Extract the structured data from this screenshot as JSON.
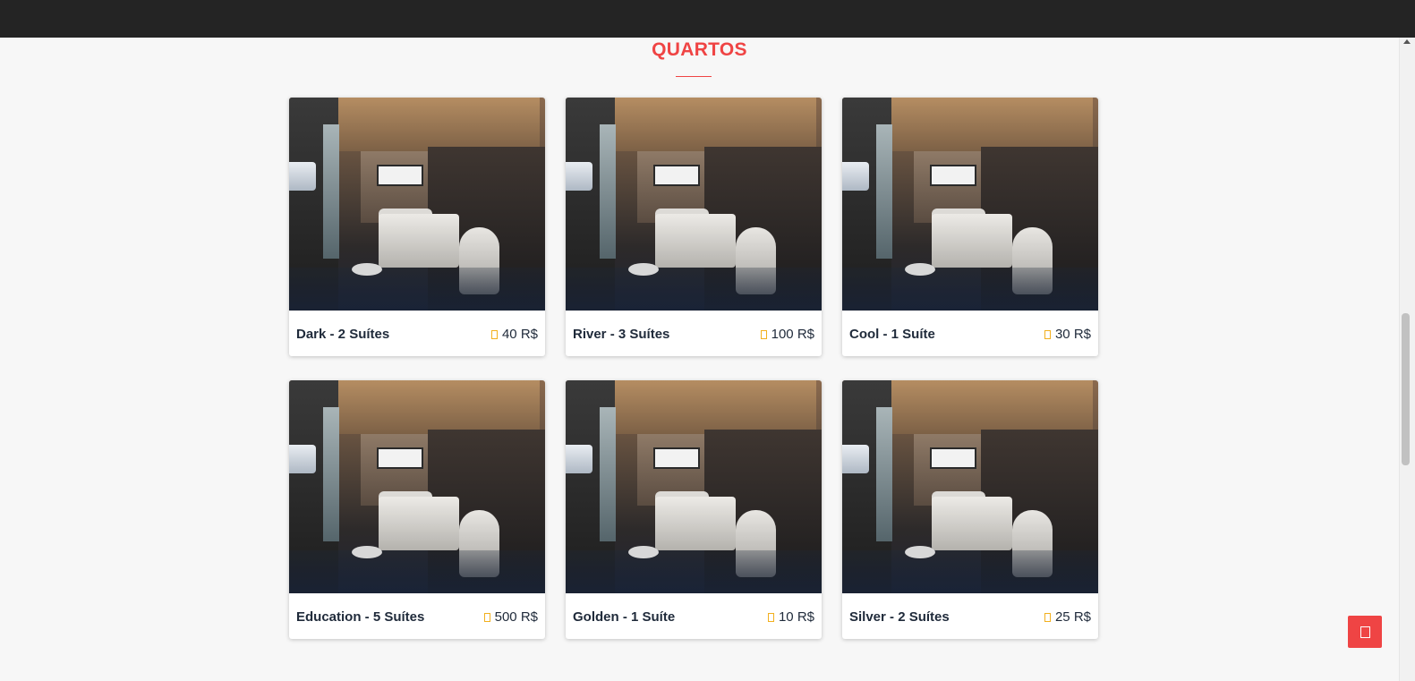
{
  "section": {
    "title": "QUARTOS"
  },
  "rooms": [
    {
      "name": "Dark - 2 Suítes",
      "price": "40 R$",
      "price_icon": "dollar-icon"
    },
    {
      "name": "River - 3 Suítes",
      "price": "100 R$",
      "price_icon": "dollar-icon"
    },
    {
      "name": "Cool - 1 Suíte",
      "price": "30 R$",
      "price_icon": "dollar-icon"
    },
    {
      "name": "Education - 5 Suítes",
      "price": "500 R$",
      "price_icon": "dollar-icon"
    },
    {
      "name": "Golden - 1 Suíte",
      "price": "10 R$",
      "price_icon": "dollar-icon"
    },
    {
      "name": "Silver - 2 Suítes",
      "price": "25 R$",
      "price_icon": "dollar-icon"
    }
  ],
  "colors": {
    "accent": "#ef4444",
    "price_icon": "#f2b01e",
    "topbar": "#242424",
    "background": "#f7f7f7"
  },
  "fab": {
    "icon": "chat-icon"
  }
}
